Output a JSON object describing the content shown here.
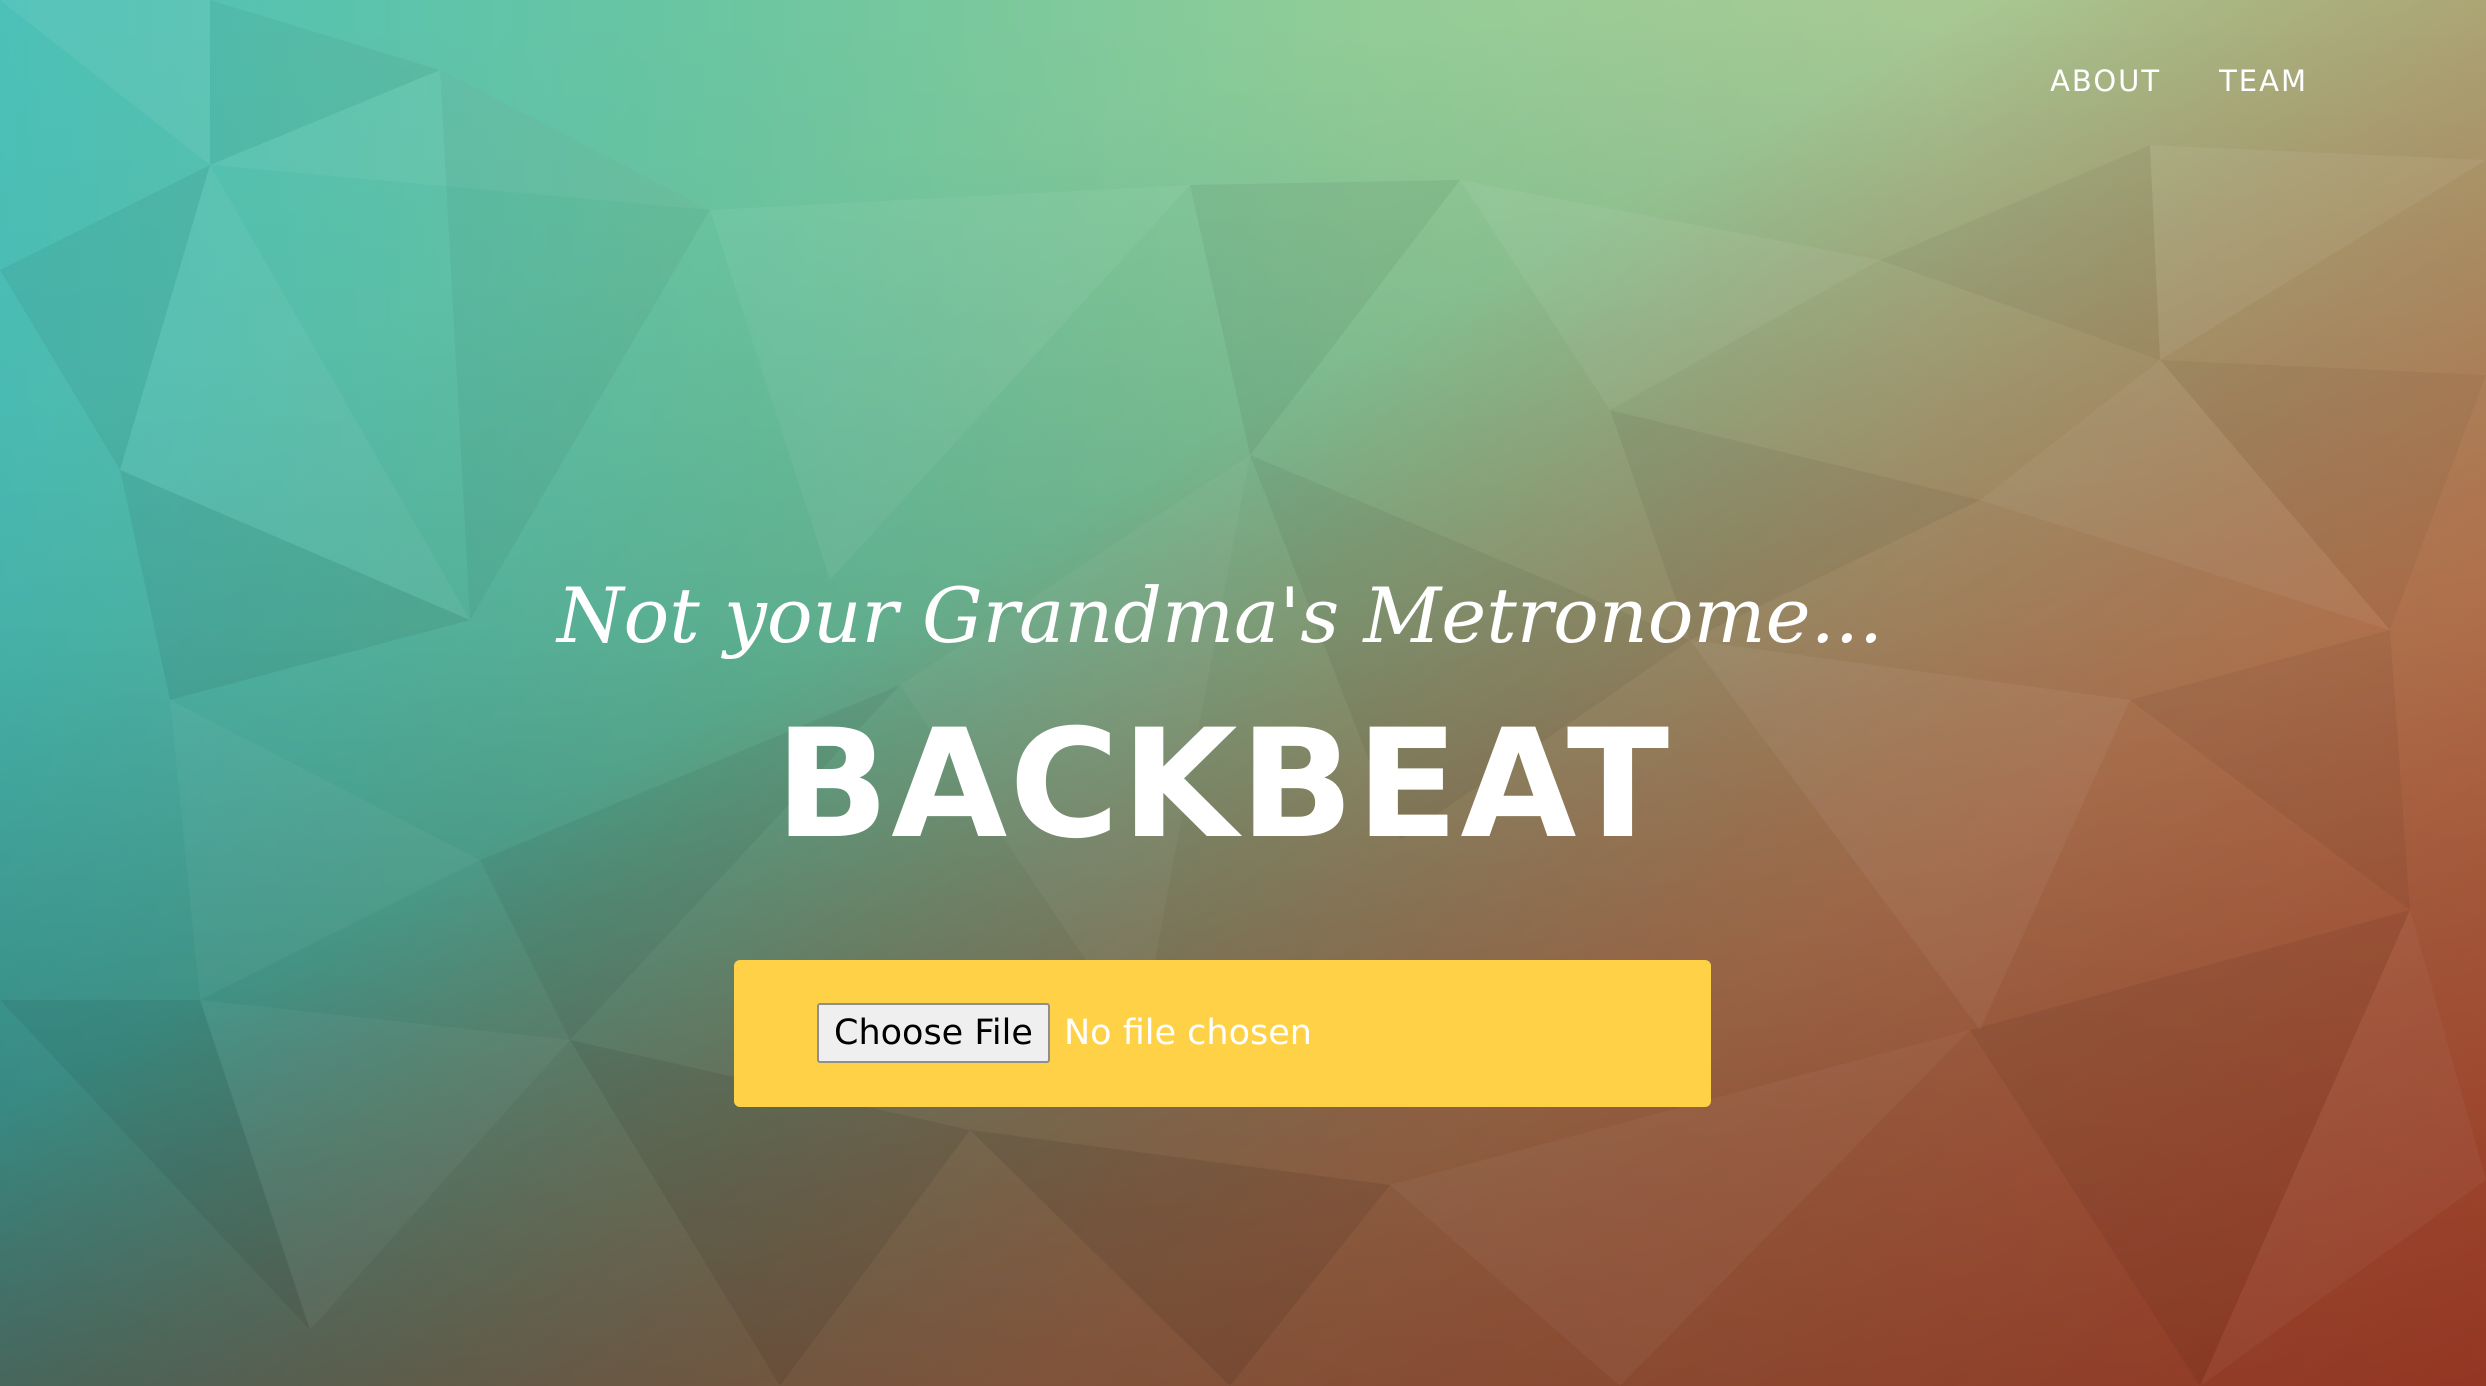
{
  "nav": {
    "items": [
      {
        "label": "ABOUT"
      },
      {
        "label": "TEAM"
      }
    ]
  },
  "hero": {
    "tagline": "Not your Grandma's Metronome...",
    "title": "BACKBEAT"
  },
  "upload": {
    "button_label": "Choose File",
    "status": "No file chosen"
  },
  "colors": {
    "upload_panel": "#ffd147",
    "text": "#ffffff",
    "bg_teal": "#3dbfb0",
    "bg_yellow": "#fde48a",
    "bg_red": "#c9442a"
  }
}
